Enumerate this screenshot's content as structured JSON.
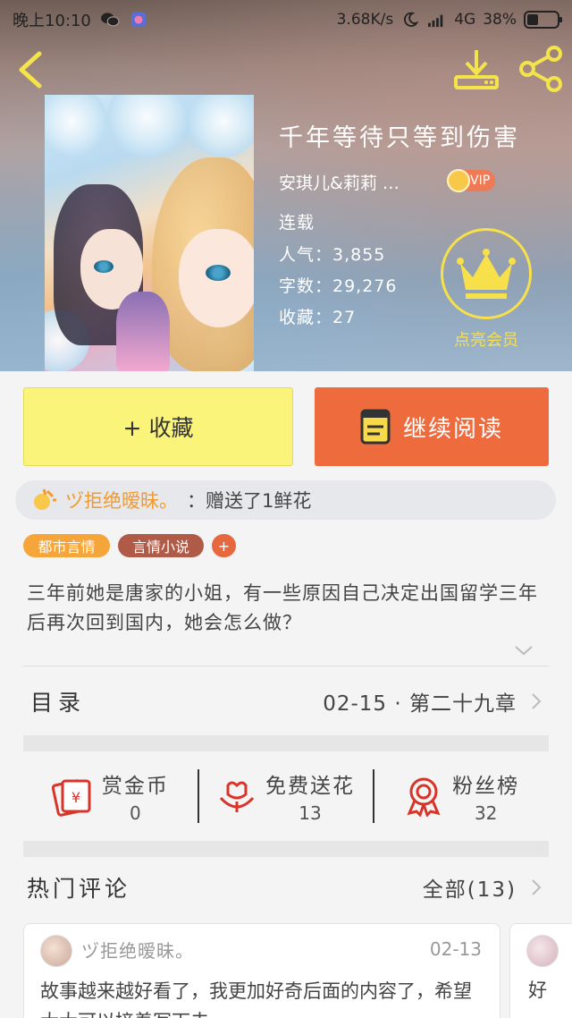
{
  "statusbar": {
    "time": "晚上10:10",
    "network_speed": "3.68K/s",
    "network_type": "4G",
    "battery": "38%"
  },
  "book": {
    "title": "千年等待只等到伤害",
    "author": "安琪儿&莉莉 …",
    "vip_label": "VIP",
    "status": "连载",
    "popularity": "人气：3,855",
    "word_count": "字数：29,276",
    "favorites": "收藏：27"
  },
  "member": {
    "label": "点亮会员"
  },
  "actions": {
    "collect_label": "+ 收藏",
    "read_label": "继续阅读"
  },
  "gift": {
    "sender": "ヅ拒绝暧昧。",
    "message": "：赠送了1鲜花"
  },
  "tags": [
    "都市言情",
    "言情小说",
    "+"
  ],
  "description": "三年前她是唐家的小姐，有一些原因自己决定出国留学三年后再次回到国内，她会怎么做？",
  "toc": {
    "label": "目录",
    "latest": "02-15 · 第二十九章"
  },
  "stats": [
    {
      "name": "赏金币",
      "value": "0",
      "icon": "red-envelope-icon"
    },
    {
      "name": "免费送花",
      "value": "13",
      "icon": "flower-icon"
    },
    {
      "name": "粉丝榜",
      "value": "32",
      "icon": "medal-icon"
    }
  ],
  "comments": {
    "label": "热门评论",
    "all": "全部(13)",
    "items": [
      {
        "user": "ヅ拒绝暧昧。",
        "date": "02-13",
        "body": "故事越来越好看了，我更加好奇后面的内容了，希望大大可以接着写下去"
      },
      {
        "user": "",
        "date": "",
        "body": "好"
      }
    ]
  },
  "colors": {
    "accent_orange": "#ed6b3d",
    "collect_yellow": "#fbf47a",
    "member_yellow": "#f7e04a",
    "tag_orange": "#f5a53a",
    "tag_brown": "#b05a48",
    "tag_plus": "#e5683e"
  }
}
